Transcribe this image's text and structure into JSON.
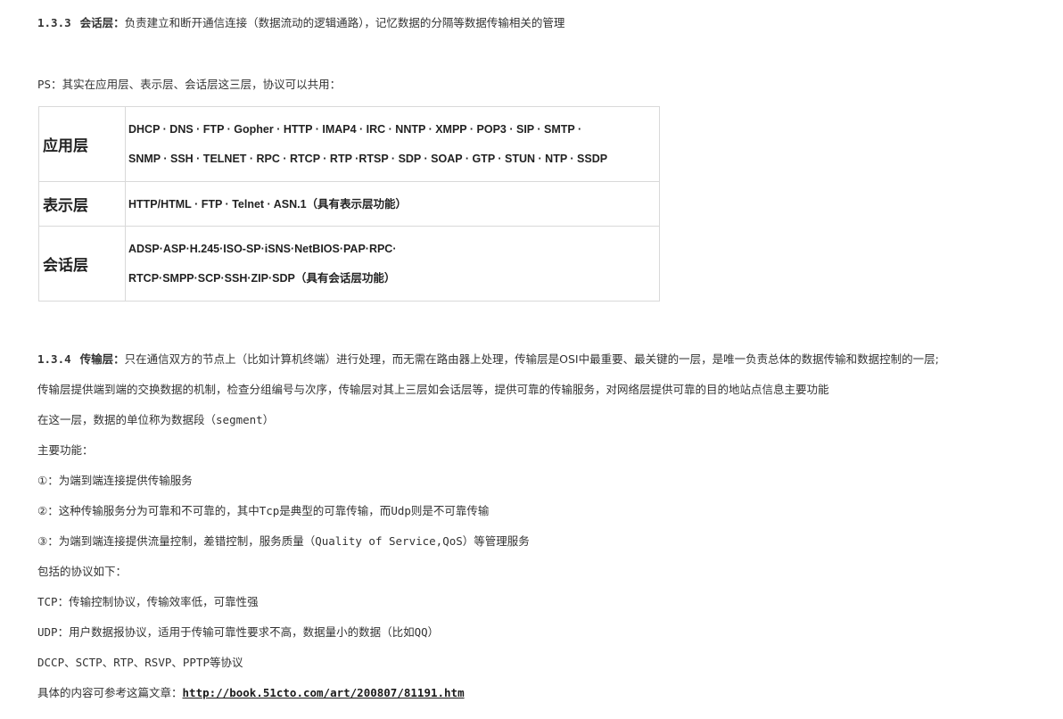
{
  "sec133": {
    "num": "1.3.3",
    "title": "会话层：",
    "desc": "负责建立和断开通信连接（数据流动的逻辑通路），记忆数据的分隔等数据传输相关的管理"
  },
  "ps": {
    "prefix": "PS：",
    "text": "其实在应用层、表示层、会话层这三层，协议可以共用："
  },
  "table": {
    "rows": [
      {
        "name": "应用层",
        "line1": "DHCP · DNS · FTP · Gopher · HTTP · IMAP4 · IRC · NNTP · XMPP · POP3 · SIP · SMTP ·",
        "line2": "SNMP · SSH · TELNET · RPC · RTCP · RTP ·RTSP · SDP · SOAP · GTP · STUN · NTP · SSDP"
      },
      {
        "name": "表示层",
        "line1": "HTTP/HTML · FTP · Telnet · ASN.1（具有表示层功能）"
      },
      {
        "name": "会话层",
        "line1": "ADSP·ASP·H.245·ISO-SP·iSNS·NetBIOS·PAP·RPC·",
        "line2": "RTCP·SMPP·SCP·SSH·ZIP·SDP（具有会话层功能）"
      }
    ]
  },
  "sec134": {
    "num": "1.3.4",
    "title": "传输层：",
    "desc1": "只在通信双方的节点上（比如计算机终端）进行处理，而无需在路由器上处理，传输层是OSI中最重要、最关键的一层，是唯一负责总体的数据传输和数据控制的一层;",
    "desc2": "传输层提供端到端的交换数据的机制，检查分组编号与次序，传输层对其上三层如会话层等，提供可靠的传输服务，对网络层提供可靠的目的地站点信息主要功能",
    "unit_prefix": "在这一层，数据的单位称为数据段（",
    "unit_word": "segment",
    "unit_suffix": "）",
    "functions_heading": "主要功能：",
    "f1": "①：为端到端连接提供传输服务",
    "f2a": "②：这种传输服务分为可靠和不可靠的，其中",
    "f2_tcp": "Tcp",
    "f2b": "是典型的可靠传输，而",
    "f2_udp": "Udp",
    "f2c": "则是不可靠传输",
    "f3a": "③：为端到端连接提供流量控制，差错控制，服务质量（",
    "f3_qos": "Quality of Service,QoS",
    "f3b": "）等管理服务",
    "protocols_heading": "包括的协议如下：",
    "tcp_label": "TCP",
    "tcp_text": "：传输控制协议，传输效率低，可靠性强",
    "udp_label": "UDP",
    "udp_text": "：用户数据报协议，适用于传输可靠性要求不高，数据量小的数据（比如",
    "udp_qq": "QQ",
    "udp_end": "）",
    "others_list": "DCCP、SCTP、RTP、RSVP、PPTP",
    "others_suffix": "等协议",
    "ref_text": "具体的内容可参考这篇文章：",
    "ref_link": "http://book.51cto.com/art/200807/81191.htm"
  }
}
